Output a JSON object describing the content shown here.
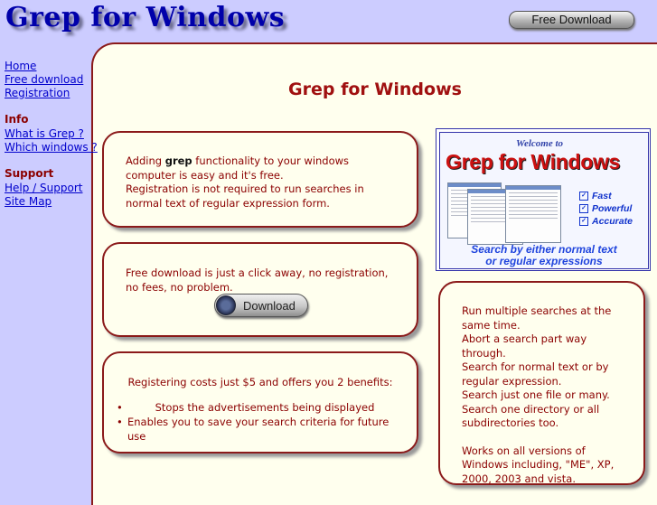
{
  "header": {
    "logo_text": "Grep for Windows",
    "free_download_label": "Free Download"
  },
  "nav": {
    "main_links": [
      "Home",
      "Free download",
      "Registration"
    ],
    "info_heading": "Info",
    "info_links": [
      "What is Grep ?",
      "Which windows ?"
    ],
    "support_heading": "Support",
    "support_links": [
      "Help / Support",
      "Site Map"
    ]
  },
  "main": {
    "title": "Grep for Windows",
    "box1": {
      "prefix": "Adding ",
      "bold": "grep",
      "line1_rest": " functionality to your windows computer is easy and it's free.",
      "line2": "Registration is not required to run searches in normal text of regular expression form."
    },
    "box2": {
      "text": "Free download is just a click away, no registration, no fees, no problem.",
      "download_label": "Download"
    },
    "box3": {
      "intro": "Registering costs just $5 and offers you 2 benefits:",
      "benefits": [
        "Stops the advertisements being displayed",
        "Enables you to save your search criteria for future use"
      ]
    },
    "banner": {
      "welcome": "Welcome to",
      "title": "Grep for Windows",
      "features": [
        "Fast",
        "Powerful",
        "Accurate"
      ],
      "search_line1": "Search by either normal text",
      "search_line2": "or regular expressions"
    },
    "box4": {
      "lines": [
        "Run multiple searches at the same time.",
        "Abort a search part way through.",
        "Search for normal text or by regular expression.",
        "Search just one file or many.",
        "Search one directory or all subdirectories too."
      ],
      "footer": "Works on all versions of Windows including, \"ME\", XP, 2000, 2003 and vista."
    }
  },
  "colors": {
    "page_bg": "#ccccff",
    "content_bg": "#ffffee",
    "accent": "#8b1a1a",
    "link": "#0000cc",
    "logo": "#0000aa"
  }
}
